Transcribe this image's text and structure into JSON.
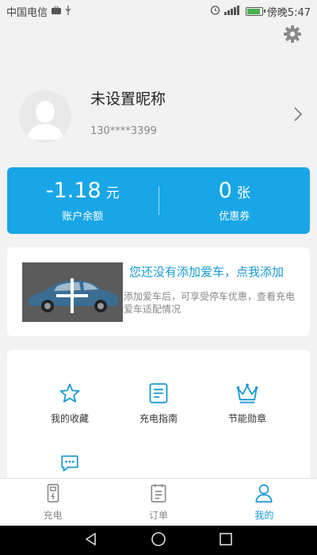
{
  "status_bar": {
    "carrier": "中国电信",
    "time": "傍晚5:47"
  },
  "profile": {
    "nickname": "未设置昵称",
    "phone": "130****3399"
  },
  "balance": {
    "amount": "-1.18",
    "amount_unit": "元",
    "amount_label": "账户余额",
    "coupons": "0",
    "coupons_unit": "张",
    "coupons_label": "优惠券"
  },
  "car": {
    "title": "您还没有添加爱车，点我添加",
    "description": "添加爱车后，可享受停车优惠，查看充电爱车适配情况"
  },
  "menu": [
    {
      "label": "我的收藏",
      "icon": "star-icon"
    },
    {
      "label": "充电指南",
      "icon": "guide-icon"
    },
    {
      "label": "节能勋章",
      "icon": "crown-icon"
    },
    {
      "label": "",
      "icon": "message-icon"
    }
  ],
  "tabs": [
    {
      "label": "充电",
      "icon": "charger-icon",
      "active": false
    },
    {
      "label": "订单",
      "icon": "order-icon",
      "active": false
    },
    {
      "label": "我的",
      "icon": "person-icon",
      "active": true
    }
  ],
  "colors": {
    "accent": "#1a9ad6",
    "card_blue": "#19a6e6",
    "background": "#f2f2f2"
  }
}
